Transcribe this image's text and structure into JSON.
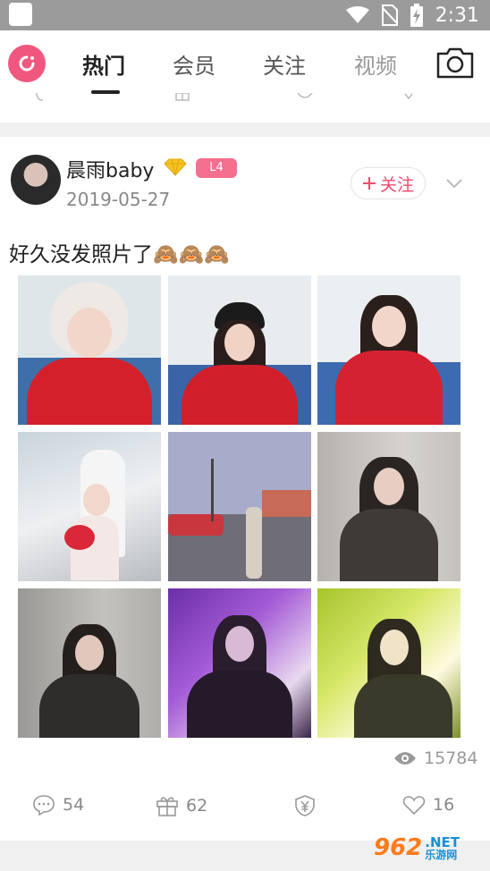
{
  "status_bar": {
    "time": "2:31"
  },
  "tabs": [
    {
      "label": "热门"
    },
    {
      "label": "会员"
    },
    {
      "label": "关注"
    },
    {
      "label": "视频"
    }
  ],
  "post": {
    "username": "晨雨baby",
    "level": "L4",
    "date": "2019-05-27",
    "follow_label": "关注",
    "text": "好久没发照片了🙈🙈🙈",
    "photos": [
      {
        "name": "bunny-hat-red-sweater"
      },
      {
        "name": "black-beret-classroom"
      },
      {
        "name": "hands-on-cheeks-classroom"
      },
      {
        "name": "bouquet-cake-display"
      },
      {
        "name": "parking-lot-street"
      },
      {
        "name": "dark-outfit-white-wall"
      },
      {
        "name": "dark-outfit-grey-wall"
      },
      {
        "name": "purple-light"
      },
      {
        "name": "yellow-green-light"
      }
    ],
    "views": "15784",
    "comments": "54",
    "gifts": "62",
    "likes": "16"
  },
  "watermark": {
    "num": "962",
    "net": ".NET",
    "cn": "乐游网"
  },
  "colors": {
    "accent": "#f0577f",
    "follow": "#ef4b6c",
    "level": "#f56f8f"
  }
}
